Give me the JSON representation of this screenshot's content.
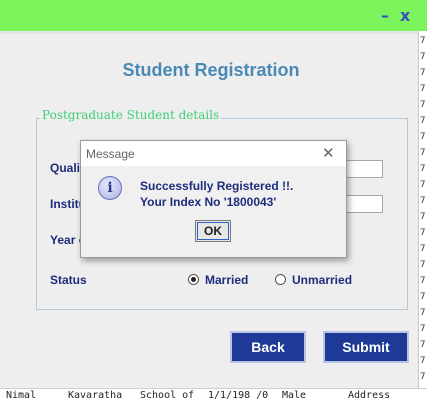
{
  "window": {
    "minimize": "–",
    "close": "x",
    "title": "Student Registration"
  },
  "form": {
    "legend": "Postgraduate Student details",
    "qualification_label": "Qualif",
    "qualification_value": ")",
    "institute_label": "Institu",
    "year_label": "Year o",
    "status_label": "Status",
    "status_options": [
      "Married",
      "Unmarried"
    ],
    "status_selected": "Married"
  },
  "buttons": {
    "back": "Back",
    "submit": "Submit"
  },
  "dialog": {
    "title": "Message",
    "close": "✕",
    "icon": "i",
    "line1": "Successfully Registered !!.",
    "line2": "Your Index No '1800043'",
    "ok": "OK"
  },
  "background": {
    "right_column": [
      "7",
      "7",
      "7",
      "7",
      "7",
      "7",
      "7",
      "7",
      "7",
      "7",
      "7",
      "7",
      "7",
      "7",
      "7",
      "7",
      "7",
      "7",
      "7",
      "7",
      "7",
      "7",
      "7"
    ],
    "bottom_row": [
      "Nimal",
      "Kavaratha",
      "School of",
      "1/1/198 /0",
      "Male",
      "Address"
    ]
  }
}
